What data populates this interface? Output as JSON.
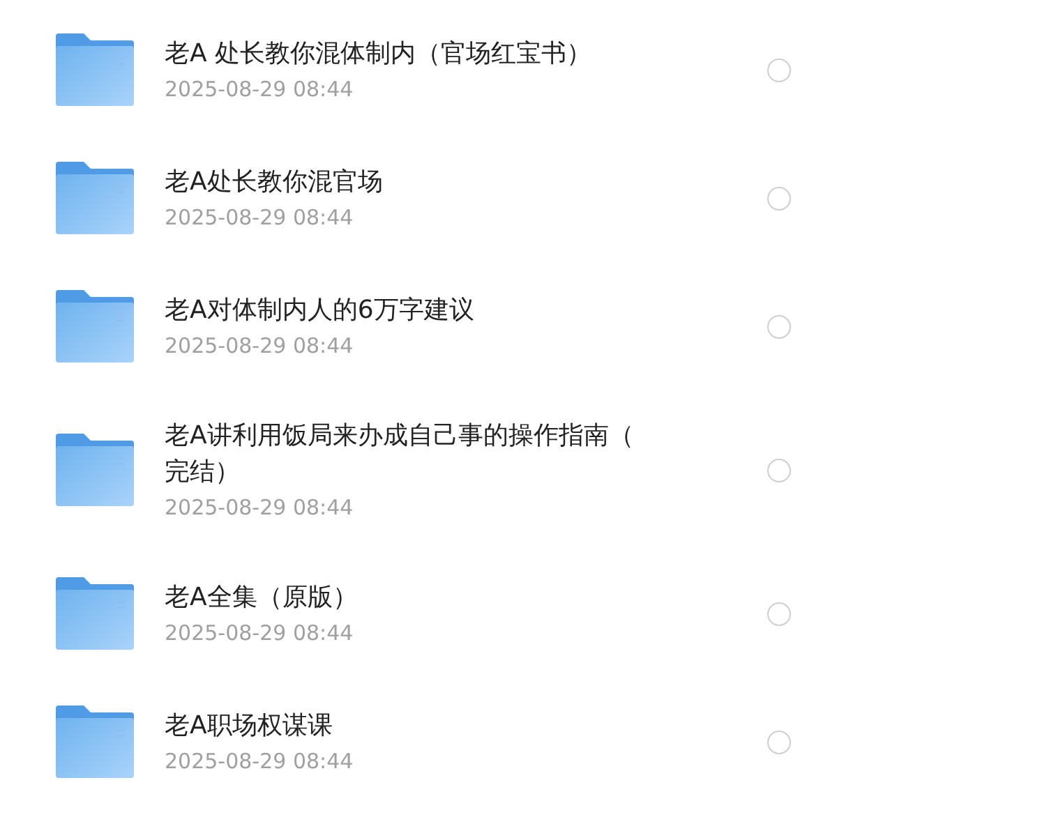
{
  "files": [
    {
      "title": "老A 处长教你混体制内（官场红宝书）",
      "date": "2025-08-29 08:44",
      "selected": false
    },
    {
      "title": "老A处长教你混官场",
      "date": "2025-08-29 08:44",
      "selected": false
    },
    {
      "title": "老A对体制内人的6万字建议",
      "date": "2025-08-29 08:44",
      "selected": false
    },
    {
      "title": "老A讲利用饭局来办成自己事的操作指南（完结）",
      "date": "2025-08-29 08:44",
      "selected": false
    },
    {
      "title": "老A全集（原版）",
      "date": "2025-08-29 08:44",
      "selected": false
    },
    {
      "title": "老A职场权谋课",
      "date": "2025-08-29 08:44",
      "selected": false
    }
  ]
}
